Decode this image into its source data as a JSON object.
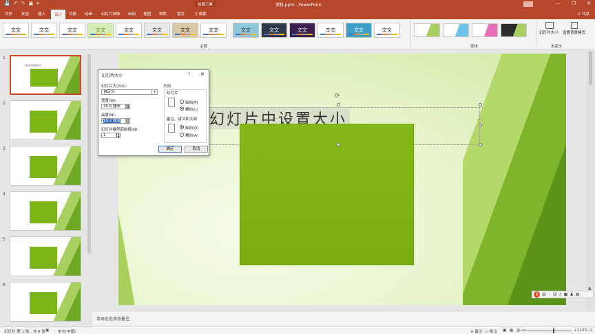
{
  "app": {
    "quick_access": [
      "💾",
      "↶",
      "↷",
      "▣",
      "▾"
    ],
    "contextual_tool": "绘图工具",
    "document_title": "资料.pptx  -  PowerPoint",
    "window_controls": [
      "—",
      "❐",
      "✕"
    ]
  },
  "tabs": [
    "文件",
    "开始",
    "插入",
    "设计",
    "切换",
    "动画",
    "幻灯片放映",
    "审阅",
    "视图",
    "帮助",
    "格式"
  ],
  "active_tab": "设计",
  "search_label": "搜索",
  "share_label": "共享",
  "ribbon": {
    "theme_label": "文文",
    "themes_group": "主题",
    "variants_group": "变体",
    "customize_group": "自定义",
    "slide_size_label": "幻灯片大小",
    "format_bg_label": "设置背景格式"
  },
  "thumbnails": [
    "1",
    "2",
    "3",
    "4",
    "5",
    "6"
  ],
  "thumb_title": "幻灯片中设置大小",
  "slide": {
    "title": "幻灯片中设置大小"
  },
  "dialog": {
    "title": "幻灯片大小",
    "help": "?",
    "close": "✕",
    "size_label": "幻灯片大小(S):",
    "size_value": "自定义",
    "width_label": "宽度(W):",
    "width_value": "25.6 厘米",
    "height_label": "高度(H):",
    "height_value": "19.2 厘米",
    "start_label": "幻灯片编号起始值(N):",
    "start_value": "1",
    "orientation_label": "方向",
    "slides_label": "幻灯片",
    "portrait_label": "纵向(P)",
    "landscape_label": "横向(L)",
    "notes_label": "备注、讲义和大纲",
    "notes_portrait_label": "纵向(O)",
    "notes_landscape_label": "横向(A)",
    "ok": "确定",
    "cancel": "取消"
  },
  "notes_placeholder": "单击此处添加备注",
  "status": {
    "slide_info": "幻灯片 第 1 张，共 8 张",
    "language": "中文(中国)",
    "notes": "备注",
    "comments": "批注",
    "zoom": "113%"
  }
}
